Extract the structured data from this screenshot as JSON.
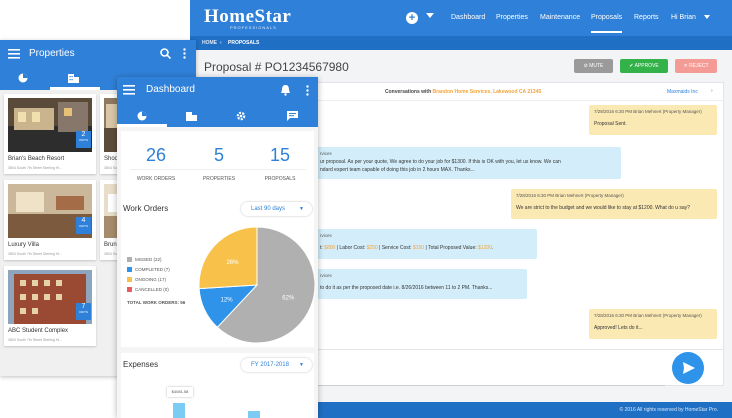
{
  "desktop": {
    "logo": "HomeStar",
    "logo_sub": "PROFESSIONALS",
    "nav": [
      "Dashboard",
      "Properties",
      "Maintenance",
      "Proposals",
      "Reports",
      "Hi Brian"
    ],
    "breadcrumb": [
      "HOME",
      "PROPOSALS"
    ],
    "page_title": "Proposal # PO1234567980",
    "buttons": {
      "mute": "MUTE",
      "approve": "APPROVE",
      "reject": "REJECT"
    },
    "conversation": {
      "header_prefix": "Conversations with",
      "header_party": "Brandon Home Services, Lakewood CA 21345",
      "link": "Maxmaids Inc",
      "messages": [
        {
          "side": "right",
          "meta": "7/28/2016 6:30 PM Brian Mehnert (Property Manager)",
          "text": "Proposal Sent."
        },
        {
          "side": "left",
          "meta": "rvices",
          "text": "ur proposal. As per your quote, We agree to do your job for $1300. If this is OK with you, let us know. We can",
          "text2": "ndard expert team capable of doing this job in 2 hours MAX. Thanks..."
        },
        {
          "side": "right",
          "meta": "7/28/2016 6:30 PM Brian Mehnert (Property Manager)",
          "text": "We are strict to the budget and we would like to stay at $1200. What do u say?"
        },
        {
          "side": "left",
          "meta": "rvices",
          "text_parts": [
            "t: ",
            "$800",
            " | Labor Cost: ",
            "$250",
            " | Service Cost: ",
            "$150",
            " | Total Proposed Value: ",
            "$1200",
            "."
          ]
        },
        {
          "side": "left",
          "meta": "rvices",
          "text": "to do it as per the proposed date i.e. 8/26/2016 between 11 to 2 PM. Thanks..."
        },
        {
          "side": "right",
          "meta": "7/28/2016 6:30 PM Brian Mehnert (Property Manager)",
          "text": "Approved! Lets do it..."
        }
      ]
    },
    "footer": "© 2016 All rights reserved by HomeStar Pro."
  },
  "properties_app": {
    "title": "Properties",
    "cards": [
      {
        "name": "Brian's Beach Resort",
        "addr": "3804 South 7th Street Sterling Hi...",
        "units": "2",
        "units_label": "UNITS"
      },
      {
        "name": "Shoo",
        "addr": "3804 South 7th",
        "units": "",
        "units_label": ""
      },
      {
        "name": "Luxury Villa",
        "addr": "3804 South 7th Street Sterling Hi...",
        "units": "4",
        "units_label": "UNITS"
      },
      {
        "name": "Brun",
        "addr": "3804 South 7th",
        "units": "",
        "units_label": ""
      },
      {
        "name": "ABC Student Complex",
        "addr": "3804 South 7th Street Sterling Hi...",
        "units": "7",
        "units_label": "UNITS"
      }
    ]
  },
  "dashboard_app": {
    "title": "Dashboard",
    "stats": [
      {
        "value": "26",
        "label": "WORK ORDERS"
      },
      {
        "value": "5",
        "label": "PROPERTIES"
      },
      {
        "value": "15",
        "label": "PROPOSALS"
      }
    ],
    "work_orders": {
      "title": "Work Orders",
      "filter": "Last 90 days",
      "legend": [
        {
          "label": "MISSED (22)",
          "color": "#b0b0b0"
        },
        {
          "label": "COMPLETED (7)",
          "color": "#2f93ea"
        },
        {
          "label": "ONGOING (17)",
          "color": "#f8c24a"
        },
        {
          "label": "CANCELLED (0)",
          "color": "#ec5b5b"
        }
      ],
      "total": "TOTAL WORK ORDERS: 56",
      "slices": [
        {
          "label": "62%",
          "value": 62,
          "color": "#b0b0b0"
        },
        {
          "label": "12%",
          "value": 12,
          "color": "#2f93ea"
        },
        {
          "label": "26%",
          "value": 26,
          "color": "#f8c24a"
        }
      ]
    },
    "expenses": {
      "title": "Expenses",
      "filter": "FY 2017-2018",
      "tooltip": "$4081.58"
    }
  },
  "colors": {
    "primary": "#2f80d8",
    "approve": "#33b24a",
    "reject": "#f59b96",
    "mute": "#9a9a9a",
    "accent": "#f3a43a"
  }
}
